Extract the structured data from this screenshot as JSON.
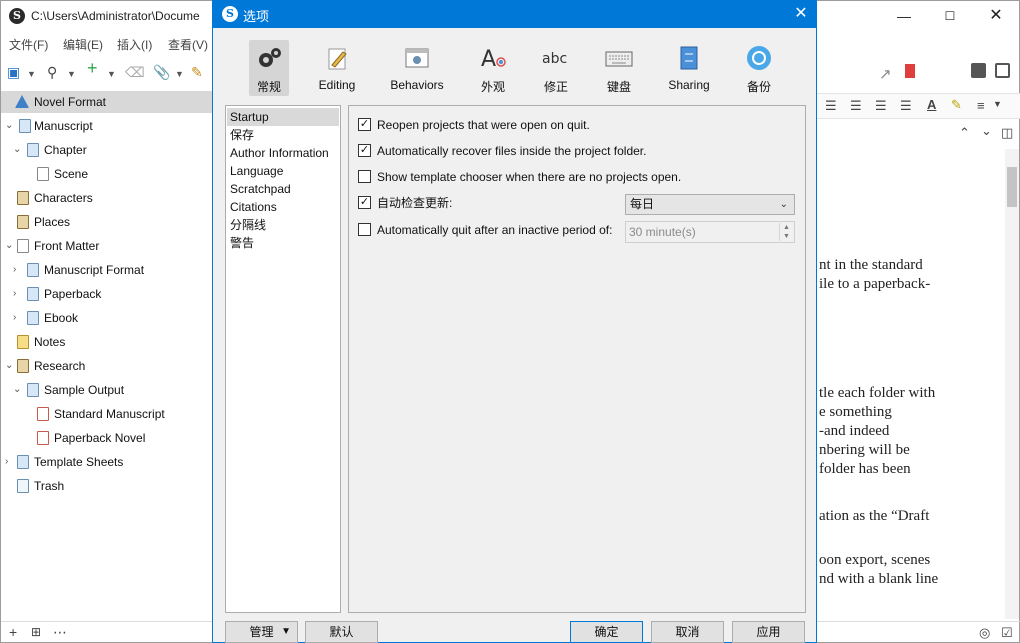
{
  "main_window": {
    "title": "C:\\Users\\Administrator\\Docume",
    "menu": [
      "文件(F)",
      "编辑(E)",
      "插入(I)",
      "查看(V)"
    ],
    "binder": [
      {
        "label": "Novel Format",
        "chev": "",
        "icon": "novel-format-icon"
      },
      {
        "label": "Manuscript",
        "chev": "⌄",
        "icon": "manuscript-icon"
      },
      {
        "label": "Chapter",
        "chev": "⌄",
        "icon": "chapter-icon"
      },
      {
        "label": "Scene",
        "chev": "",
        "icon": "scene-icon"
      },
      {
        "label": "Characters",
        "chev": "",
        "icon": "characters-icon"
      },
      {
        "label": "Places",
        "chev": "",
        "icon": "places-icon"
      },
      {
        "label": "Front Matter",
        "chev": "⌄",
        "icon": "front-matter-icon"
      },
      {
        "label": "Manuscript Format",
        "chev": "›",
        "icon": "folder-icon"
      },
      {
        "label": "Paperback",
        "chev": "›",
        "icon": "folder-icon"
      },
      {
        "label": "Ebook",
        "chev": "›",
        "icon": "folder-icon"
      },
      {
        "label": "Notes",
        "chev": "",
        "icon": "notes-icon"
      },
      {
        "label": "Research",
        "chev": "⌄",
        "icon": "research-icon"
      },
      {
        "label": "Sample Output",
        "chev": "⌄",
        "icon": "folder-icon"
      },
      {
        "label": "Standard Manuscript",
        "chev": "",
        "icon": "pdf-icon"
      },
      {
        "label": "Paperback Novel",
        "chev": "",
        "icon": "pdf-icon"
      },
      {
        "label": "Template Sheets",
        "chev": "›",
        "icon": "template-sheets-icon"
      },
      {
        "label": "Trash",
        "chev": "",
        "icon": "trash-icon"
      }
    ],
    "editor_lines": [
      "nt in the standard",
      "ile to a paperback-",
      "",
      "",
      "",
      "",
      "tle each folder with",
      "e something",
      "-and indeed",
      "nbering will be",
      " folder has been",
      "",
      "ation as the “Draft",
      "",
      "oon export, scenes",
      "nd with a blank line"
    ]
  },
  "dialog": {
    "title": "选项",
    "tabs": [
      "常规",
      "Editing",
      "Behaviors",
      "外观",
      "修正",
      "键盘",
      "Sharing",
      "备份"
    ],
    "correction_icon_text": "abc",
    "categories": [
      "Startup",
      "保存",
      "Author Information",
      "Language",
      "Scratchpad",
      "Citations",
      "分隔线",
      "警告"
    ],
    "options": [
      {
        "label": "Reopen projects that were open on quit.",
        "checked": true
      },
      {
        "label": "Automatically recover files inside the project folder.",
        "checked": true
      },
      {
        "label": "Show template chooser when there are no projects open.",
        "checked": false
      },
      {
        "label": "自动检查更新:",
        "checked": true
      },
      {
        "label": "Automatically quit after an inactive period of:",
        "checked": false
      }
    ],
    "update_frequency": "每日",
    "quit_period": "30 minute(s)",
    "buttons": {
      "manage": "管理",
      "default": "默认",
      "ok": "确定",
      "cancel": "取消",
      "apply": "应用"
    }
  }
}
